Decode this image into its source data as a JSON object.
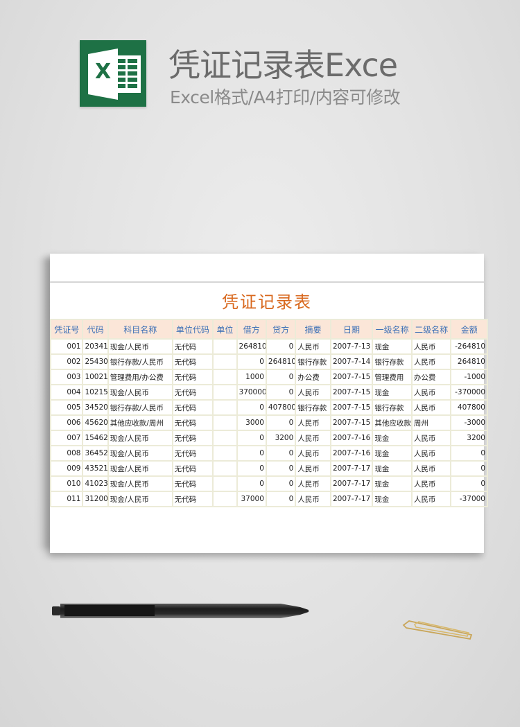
{
  "header": {
    "title": "凭证记录表Exce",
    "subtitle": "Excel格式/A4打印/内容可修改",
    "logo_letter": "X",
    "logo_color": "#1e7145"
  },
  "sheet": {
    "title": "凭证记录表",
    "title_color": "#d8671c",
    "header_bg": "#fbe6d8",
    "header_text_color": "#3b6fb6",
    "columns": [
      "凭证号",
      "代码",
      "科目名称",
      "单位代码",
      "单位",
      "借方",
      "贷方",
      "摘要",
      "日期",
      "一级名称",
      "二级名称",
      "金额"
    ],
    "rows": [
      [
        "001",
        "20341",
        "现金/人民币",
        "无代码",
        "",
        "264810",
        "0",
        "人民币",
        "2007-7-13",
        "现金",
        "人民币",
        "-264810"
      ],
      [
        "002",
        "25430",
        "银行存款/人民币",
        "无代码",
        "",
        "0",
        "264810",
        "银行存款",
        "2007-7-14",
        "银行存款",
        "人民币",
        "264810"
      ],
      [
        "003",
        "10021",
        "管理费用/办公费",
        "无代码",
        "",
        "1000",
        "0",
        "办公费",
        "2007-7-15",
        "管理费用",
        "办公费",
        "-1000"
      ],
      [
        "004",
        "10215",
        "现金/人民币",
        "无代码",
        "",
        "370000",
        "0",
        "人民币",
        "2007-7-15",
        "现金",
        "人民币",
        "-370000"
      ],
      [
        "005",
        "34520",
        "银行存款/人民币",
        "无代码",
        "",
        "0",
        "407800",
        "银行存款",
        "2007-7-15",
        "银行存款",
        "人民币",
        "407800"
      ],
      [
        "006",
        "45620",
        "其他应收款/周州",
        "无代码",
        "",
        "3000",
        "0",
        "人民币",
        "2007-7-15",
        "其他应收款",
        "周州",
        "-3000"
      ],
      [
        "007",
        "15462",
        "现金/人民币",
        "无代码",
        "",
        "0",
        "3200",
        "人民币",
        "2007-7-16",
        "现金",
        "人民币",
        "3200"
      ],
      [
        "008",
        "36452",
        "现金/人民币",
        "无代码",
        "",
        "0",
        "0",
        "人民币",
        "2007-7-16",
        "现金",
        "人民币",
        "0"
      ],
      [
        "009",
        "43521",
        "现金/人民币",
        "无代码",
        "",
        "0",
        "0",
        "人民币",
        "2007-7-17",
        "现金",
        "人民币",
        "0"
      ],
      [
        "010",
        "41023",
        "现金/人民币",
        "无代码",
        "",
        "0",
        "0",
        "人民币",
        "2007-7-17",
        "现金",
        "人民币",
        "0"
      ],
      [
        "011",
        "31200",
        "现金/人民币",
        "无代码",
        "",
        "37000",
        "0",
        "人民币",
        "2007-7-17",
        "现金",
        "人民币",
        "-37000"
      ]
    ]
  },
  "decor": {
    "pen": "pen-image",
    "paperclip": "paperclip-image"
  }
}
